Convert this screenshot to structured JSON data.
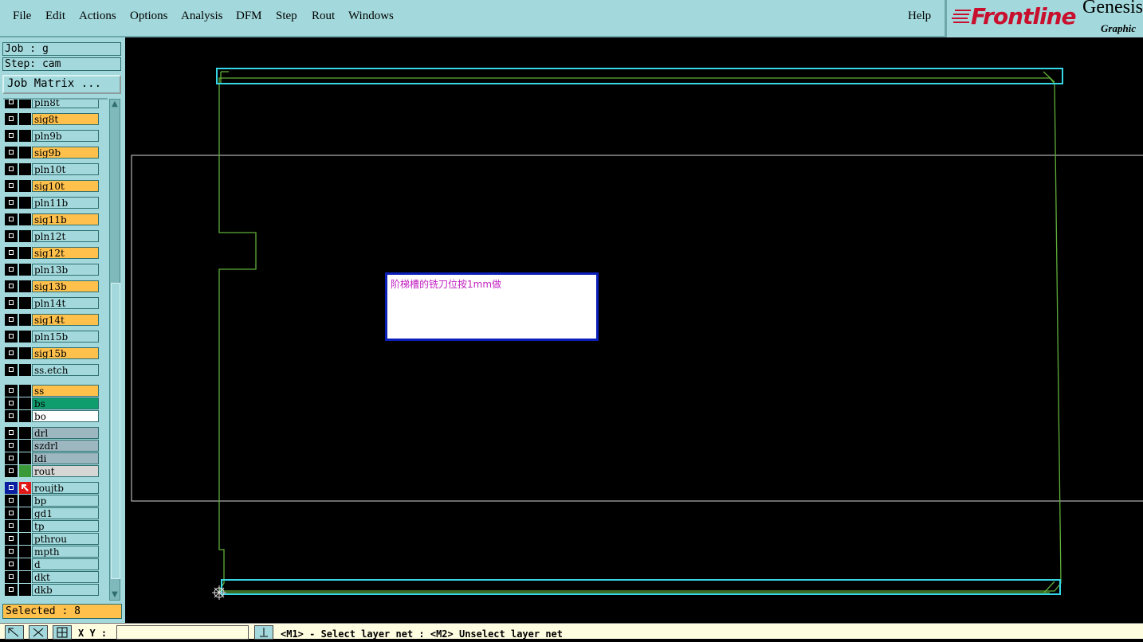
{
  "menu": {
    "items": [
      "File",
      "Edit",
      "Actions",
      "Options",
      "Analysis",
      "DFM",
      "Step",
      "Rout",
      "Windows"
    ],
    "help": "Help"
  },
  "logo": {
    "brand": "Frontline",
    "product": "Genesis",
    "subtitle": "Graphic E"
  },
  "job": {
    "label": "Job : g",
    "step": "Step: cam",
    "matrix_button": "Job Matrix ..."
  },
  "layers": [
    {
      "name": "pln8t",
      "color": "#a3d9dc",
      "text": "#000"
    },
    {
      "name": "sig8t",
      "color": "#ffc04c",
      "text": "#000"
    },
    {
      "name": "pln9b",
      "color": "#a3d9dc",
      "text": "#000"
    },
    {
      "name": "sig9b",
      "color": "#ffc04c",
      "text": "#000"
    },
    {
      "name": "pln10t",
      "color": "#a3d9dc",
      "text": "#000"
    },
    {
      "name": "sig10t",
      "color": "#ffc04c",
      "text": "#000"
    },
    {
      "name": "pln11b",
      "color": "#a3d9dc",
      "text": "#000"
    },
    {
      "name": "sig11b",
      "color": "#ffc04c",
      "text": "#000"
    },
    {
      "name": "pln12t",
      "color": "#a3d9dc",
      "text": "#000"
    },
    {
      "name": "sig12t",
      "color": "#ffc04c",
      "text": "#000"
    },
    {
      "name": "pln13b",
      "color": "#a3d9dc",
      "text": "#000"
    },
    {
      "name": "sig13b",
      "color": "#ffc04c",
      "text": "#000"
    },
    {
      "name": "pln14t",
      "color": "#a3d9dc",
      "text": "#000"
    },
    {
      "name": "sig14t",
      "color": "#ffc04c",
      "text": "#000"
    },
    {
      "name": "pln15b",
      "color": "#a3d9dc",
      "text": "#000"
    },
    {
      "name": "sig15b",
      "color": "#ffc04c",
      "text": "#000"
    },
    {
      "name": "ss.etch",
      "color": "#a3d9dc",
      "text": "#000"
    },
    {
      "name": "ss",
      "color": "#ffc04c",
      "text": "#000"
    },
    {
      "name": "bs",
      "color": "#0f9d6e",
      "text": "#000"
    },
    {
      "name": "bo",
      "color": "#ffffff",
      "text": "#000"
    },
    {
      "name": "drl",
      "color": "#9db7c0",
      "text": "#000"
    },
    {
      "name": "szdrl",
      "color": "#9db7c0",
      "text": "#000"
    },
    {
      "name": "ldi",
      "color": "#9db7c0",
      "text": "#000"
    },
    {
      "name": "rout",
      "color": "#d6d6d6",
      "text": "#000",
      "slot_color": "#3a9a3a"
    },
    {
      "name": "roujtb",
      "color": "#a3d9dc",
      "text": "#000",
      "work": true
    },
    {
      "name": "bp",
      "color": "#a3d9dc",
      "text": "#000"
    },
    {
      "name": "gd1",
      "color": "#a3d9dc",
      "text": "#000"
    },
    {
      "name": "tp",
      "color": "#a3d9dc",
      "text": "#000"
    },
    {
      "name": "pthrou",
      "color": "#a3d9dc",
      "text": "#000"
    },
    {
      "name": "mpth",
      "color": "#a3d9dc",
      "text": "#000"
    },
    {
      "name": "d",
      "color": "#a3d9dc",
      "text": "#000"
    },
    {
      "name": "dkt",
      "color": "#a3d9dc",
      "text": "#000"
    },
    {
      "name": "dkb",
      "color": "#a3d9dc",
      "text": "#000"
    }
  ],
  "selected": "Selected : 8",
  "note_text": "阶梯槽的铣刀位按1mm做",
  "status": {
    "xy_label": "X Y :",
    "xy_value": "",
    "message": "<M1> - Select layer net : <M2> Unselect layer net"
  },
  "colors": {
    "panel": "#a3d9dc",
    "outline": "#5fae3a",
    "cyan": "#35d6e6",
    "note_border": "#0a1fb8"
  }
}
